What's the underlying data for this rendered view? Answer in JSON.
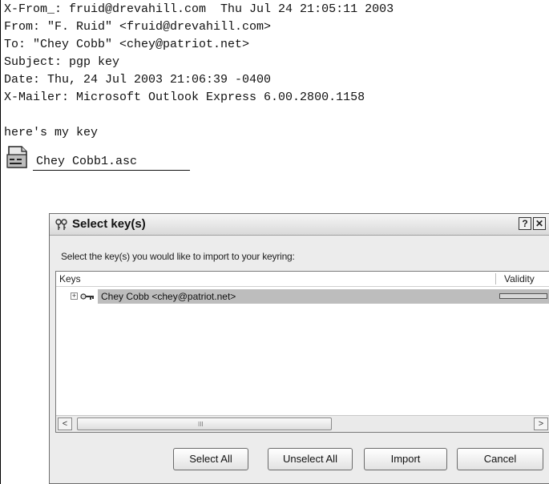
{
  "email": {
    "headers": [
      "X-From_: fruid@drevahill.com  Thu Jul 24 21:05:11 2003",
      "From: \"F. Ruid\" <fruid@drevahill.com>",
      "To: \"Chey Cobb\" <chey@patriot.net>",
      "Subject: pgp key",
      "Date: Thu, 24 Jul 2003 21:06:39 -0400",
      "X-Mailer: Microsoft Outlook Express 6.00.2800.1158"
    ],
    "body": "here's my key",
    "attachment": {
      "filename": "Chey Cobb1.asc",
      "icon": "file-icon"
    }
  },
  "dialog": {
    "title": "Select key(s)",
    "title_icon": "keys-icon",
    "help_glyph": "?",
    "close_glyph": "✕",
    "instruction": "Select the key(s) you would like to import to your keyring:",
    "columns": [
      "Keys",
      "Validity"
    ],
    "rows": [
      {
        "expander": "+",
        "icon": "key-icon",
        "label": "Chey Cobb <chey@patriot.net>",
        "validity": 0
      }
    ],
    "scroll_left": "<",
    "scroll_right": ">",
    "scroll_grip": "III",
    "buttons": {
      "select_all": "Select All",
      "unselect_all": "Unselect All",
      "import": "Import",
      "cancel": "Cancel"
    }
  }
}
